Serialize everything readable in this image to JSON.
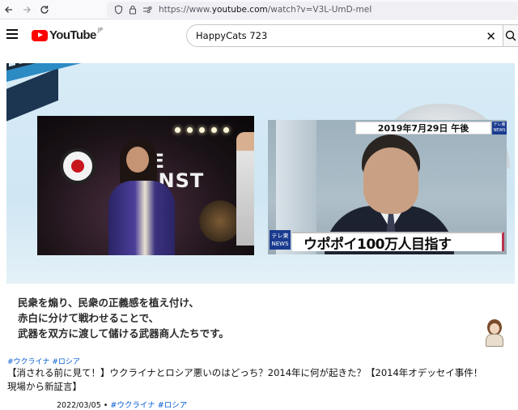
{
  "browser": {
    "url_prefix": "https://www.",
    "url_host": "youtube.com",
    "url_path": "/watch?v=V3L-UmD-meI"
  },
  "header": {
    "logo_text": "YouTube",
    "region": "JP",
    "search_value": "HappyCats 723"
  },
  "video_frame": {
    "left_photo_banner": "GE\nAINST",
    "date_caption": "2019年7月29日 午後",
    "tv_logo_top": "テレ東\nNEWS",
    "tv_logo_bottom": "テレ東\nNEWS",
    "caption": "ウポポイ100万人目指す",
    "subtitle_lines": [
      "民衆を煽り、民衆の正義感を植え付け、",
      "赤白に分けて戦わせることで、",
      "武器を双方に渡して儲ける武器商人たちです。"
    ]
  },
  "info": {
    "hashtags": [
      "#ウクライナ",
      "#ロシア"
    ],
    "title_line1": "【消される前に見て！】ウクライナとロシア悪いのはどっち？2014年に何が起きた？【2014年オデッセイ事件！",
    "title_line2": "現場から新証言】",
    "date": "2022/03/05",
    "meta_tags": [
      "#ウクライナ",
      "#ロシア"
    ]
  },
  "colors": {
    "brand_red": "#ff0000",
    "link_blue": "#065fd4",
    "caption_accent": "#b8324c"
  }
}
